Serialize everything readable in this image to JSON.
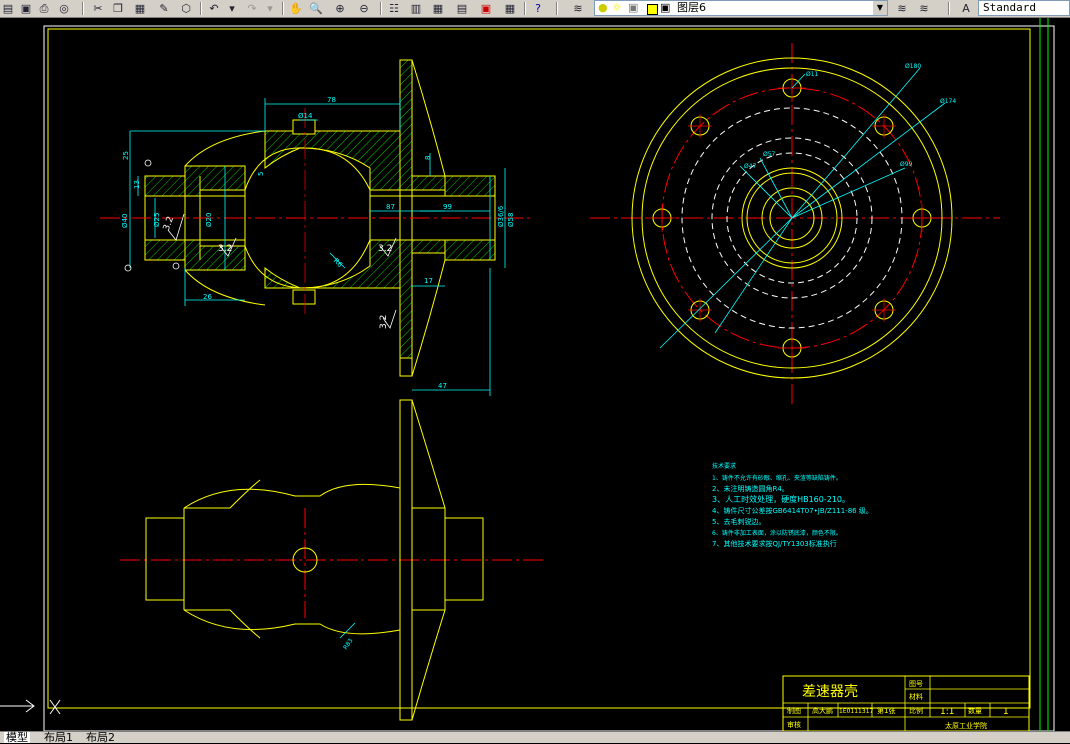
{
  "toolbar": {
    "layer_name": "图层6",
    "text_style": "Standard"
  },
  "drawing": {
    "dims": {
      "d78": "78",
      "d14": "Ø14",
      "d25": "25",
      "d13": "13",
      "d5": "5",
      "d40": "Ø40",
      "d25b": "Ø25",
      "d8": "8",
      "d20": "Ø20",
      "d87": "87",
      "d99": "99",
      "d36": "Ø36/6",
      "d58": "Ø58",
      "d26": "26",
      "d17": "17",
      "d47": "47",
      "d11": "Ø11",
      "d180": "Ø180",
      "d174": "Ø174",
      "d57": "Ø57",
      "d47b": "Ø47",
      "d99b": "Ø99",
      "r6": "R6",
      "rough1": "3.2",
      "rough2": "3.2",
      "rough3": "3.2",
      "rough4": "3.2",
      "rough5": "3.2",
      "r83": "R83"
    },
    "notes": {
      "title": "技术要求",
      "items": [
        "1、铸件不允许有砂眼、缩孔、夹渣等缺陷铸件。",
        "2、未注明铸造圆角R4。",
        "3、人工时效处理，硬度HB160-210。",
        "4、铸件尺寸公差按GB6414T07•JB/Z111-86 级。",
        "5、去毛刺锐边。",
        "6、铸件非加工表面，涂以防锈底漆，颜色不限。",
        "7、其他技术要求按QJ/TY1303标准执行"
      ]
    },
    "title_block": {
      "part_name": "差速器壳",
      "label_figno": "图号",
      "label_material": "材料",
      "label_scale": "比例",
      "label_qty": "数量",
      "label_designer": "制图",
      "designer": "高大鹏",
      "student_id": "1E0111317",
      "sheet": "第1张",
      "scale": "1:1",
      "quantity": "1",
      "label_check": "审核",
      "school": "太原工业学院"
    }
  },
  "status": {
    "tab_model": "模型",
    "tab_layout1": "布局1",
    "tab_layout2": "布局2"
  },
  "colors": {
    "background": "#000000",
    "outline": "#ffff00",
    "center_line": "#ff0000",
    "dimension": "#00ffff",
    "hidden": "#ffffff",
    "hatch": "#00ff00"
  }
}
